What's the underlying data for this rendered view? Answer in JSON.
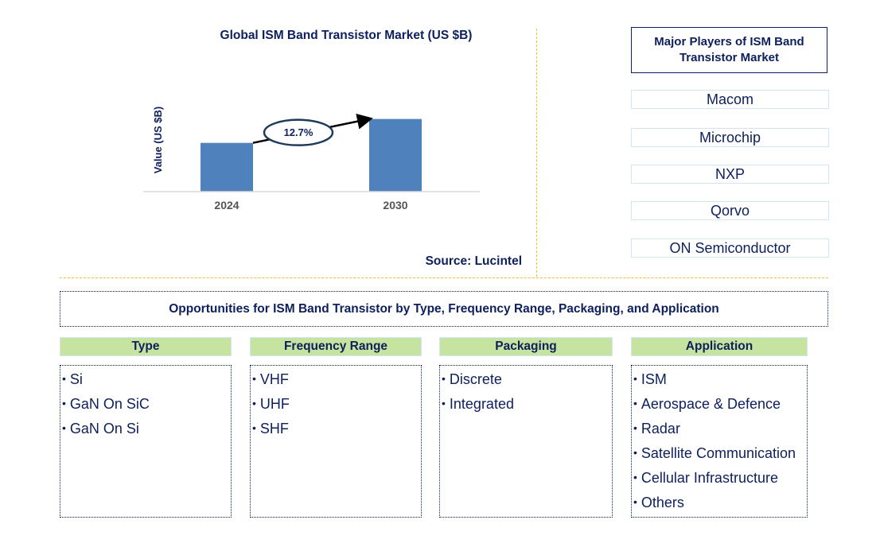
{
  "chart_data": {
    "type": "bar",
    "title": "Global ISM Band Transistor Market (US $B)",
    "xlabel": "",
    "ylabel": "Value (US $B)",
    "categories": [
      "2024",
      "2030"
    ],
    "values": [
      1.0,
      1.49
    ],
    "value_units": "relative (no y-axis ticks shown)",
    "ylim": [
      0,
      2.3
    ],
    "grid": false,
    "bar_color": "#4f81bd",
    "annotation": {
      "label": "12.7%",
      "meaning": "CAGR arrow from 2024 to 2030"
    },
    "source": "Source: Lucintel"
  },
  "players": {
    "title": "Major Players of ISM Band Transistor Market",
    "items": [
      "Macom",
      "Microchip",
      "NXP",
      "Qorvo",
      "ON Semiconductor"
    ]
  },
  "opportunities": {
    "title": "Opportunities for ISM Band Transistor by Type, Frequency Range, Packaging, and Application",
    "segments": [
      {
        "heading": "Type",
        "items": [
          "Si",
          "GaN On SiC",
          "GaN On Si"
        ]
      },
      {
        "heading": "Frequency Range",
        "items": [
          "VHF",
          "UHF",
          "SHF"
        ]
      },
      {
        "heading": "Packaging",
        "items": [
          "Discrete",
          "Integrated"
        ]
      },
      {
        "heading": "Application",
        "items": [
          "ISM",
          "Aerospace & Defence",
          "Radar",
          "Satellite Communication",
          "Cellular Infrastructure",
          "Others"
        ]
      }
    ]
  },
  "colors": {
    "text_navy": "#0d1f5c",
    "bar_blue": "#4f81bd",
    "segment_header_green": "#c6e3a0",
    "divider_gold": "#f5c02a",
    "player_border": "#d3e6f4"
  }
}
